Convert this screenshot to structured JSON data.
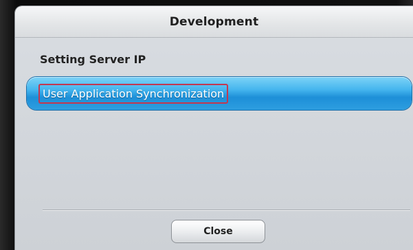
{
  "dialog": {
    "title": "Development",
    "items": [
      {
        "label": "Setting Server IP"
      },
      {
        "label": "User Application Synchronization",
        "selected": true
      }
    ],
    "close_label": "Close"
  },
  "colors": {
    "selection": "#2d9ee0",
    "highlight_box": "#c4374f"
  }
}
